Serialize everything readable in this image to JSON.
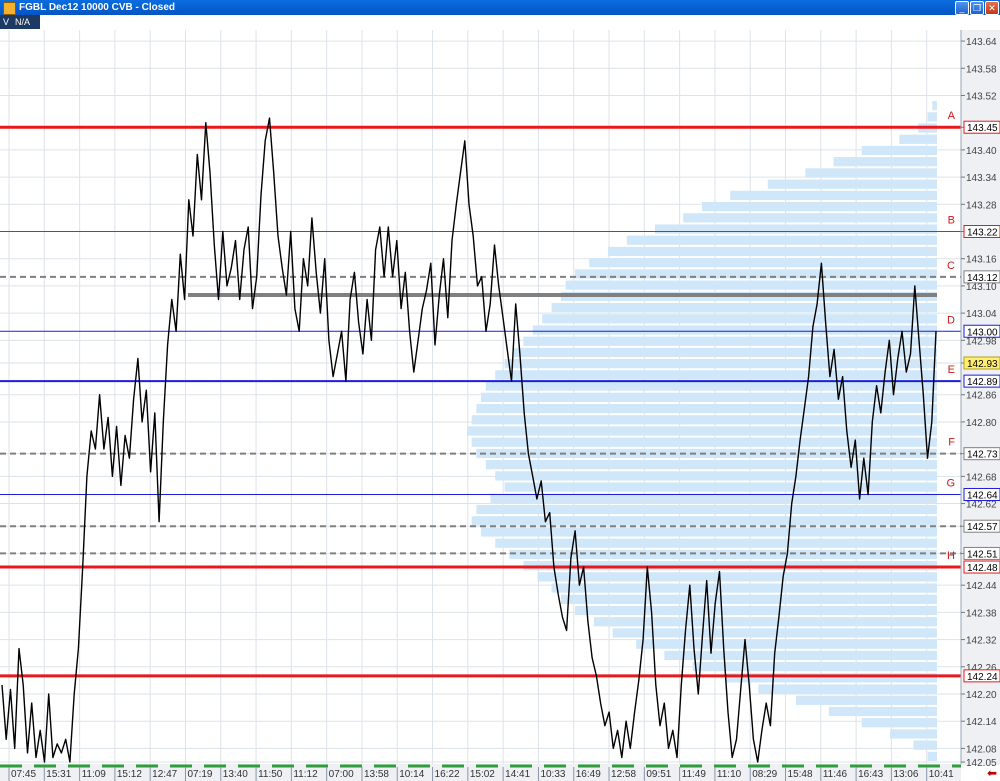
{
  "window": {
    "title": "FGBL Dec12 10000 CVB - Closed",
    "buttons": [
      "_",
      "❐",
      "✕"
    ]
  },
  "toolbar": {
    "v_label": "V",
    "na_label": "N/A"
  },
  "colors": {
    "price_line": "#000000",
    "profile_fill": "#cfe7f8",
    "red_level": "#e8181c",
    "blue_level": "#1d1de0",
    "gray_level": "#808080",
    "label_red": "#d01818",
    "current_price_box": "#ffee70"
  },
  "chart_data": {
    "type": "line",
    "title": "",
    "ylim": [
      142.05,
      143.66
    ],
    "y_ticks": [
      "143.64",
      "143.58",
      "143.52",
      "143.45",
      "143.40",
      "143.34",
      "143.28",
      "143.22",
      "143.16",
      "143.10",
      "143.04",
      "142.98",
      "142.93",
      "142.86",
      "142.80",
      "142.73",
      "142.68",
      "142.62",
      "142.57",
      "142.51",
      "142.44",
      "142.38",
      "142.32",
      "142.26",
      "142.20",
      "142.14",
      "142.08",
      "142.05"
    ],
    "x_ticks": [
      "07:45",
      "15:31",
      "11:09",
      "15:12",
      "12:47",
      "07:19",
      "13:40",
      "11:50",
      "11:12",
      "07:00",
      "13:58",
      "10:14",
      "16:22",
      "15:02",
      "14:41",
      "10:33",
      "16:49",
      "12:58",
      "09:51",
      "11:49",
      "11:10",
      "08:29",
      "15:48",
      "11:46",
      "16:43",
      "13:06",
      "10:41"
    ],
    "current_price": "142.93",
    "series": [
      {
        "values": [
          142.22,
          142.1,
          142.21,
          142.08,
          142.3,
          142.22,
          142.07,
          142.18,
          142.06,
          142.12,
          142.05,
          142.2,
          142.06,
          142.09,
          142.07,
          142.1,
          142.05,
          142.2,
          142.3,
          142.48,
          142.68,
          142.78,
          142.74,
          142.86,
          142.74,
          142.81,
          142.68,
          142.79,
          142.66,
          142.77,
          142.72,
          142.85,
          142.94,
          142.8,
          142.87,
          142.69,
          142.82,
          142.58,
          142.8,
          142.97,
          143.07,
          143.0,
          143.17,
          143.07,
          143.29,
          143.21,
          143.39,
          143.29,
          143.46,
          143.35,
          143.19,
          143.07,
          143.22,
          143.1,
          143.14,
          143.2,
          143.07,
          143.18,
          143.23,
          143.05,
          143.12,
          143.3,
          143.42,
          143.47,
          143.35,
          143.21,
          143.14,
          143.08,
          143.22,
          143.05,
          143.0,
          143.16,
          143.1,
          143.25,
          143.13,
          143.04,
          143.16,
          142.98,
          142.9,
          142.95,
          143.0,
          142.89,
          143.07,
          143.13,
          143.02,
          142.95,
          143.07,
          142.98,
          143.18,
          143.23,
          143.12,
          143.23,
          143.12,
          143.2,
          143.05,
          143.13,
          143.0,
          142.91,
          142.98,
          143.05,
          143.09,
          143.15,
          142.97,
          143.08,
          143.16,
          143.03,
          143.2,
          143.28,
          143.35,
          143.42,
          143.28,
          143.21,
          143.1,
          143.12,
          143.0,
          143.06,
          143.19,
          143.1,
          143.03,
          142.96,
          142.89,
          143.06,
          142.95,
          142.82,
          142.73,
          142.68,
          142.63,
          142.67,
          142.58,
          142.6,
          142.48,
          142.42,
          142.37,
          142.34,
          142.5,
          142.56,
          142.44,
          142.48,
          142.36,
          142.28,
          142.24,
          142.18,
          142.13,
          142.16,
          142.08,
          142.12,
          142.06,
          142.14,
          142.08,
          142.16,
          142.23,
          142.32,
          142.48,
          142.38,
          142.22,
          142.13,
          142.18,
          142.08,
          142.12,
          142.06,
          142.22,
          142.34,
          142.44,
          142.3,
          142.2,
          142.33,
          142.45,
          142.29,
          142.4,
          142.47,
          142.3,
          142.16,
          142.06,
          142.1,
          142.21,
          142.32,
          142.22,
          142.1,
          142.05,
          142.12,
          142.18,
          142.13,
          142.29,
          142.37,
          142.46,
          142.51,
          142.62,
          142.68,
          142.76,
          142.83,
          142.9,
          143.01,
          143.06,
          143.15,
          143.02,
          142.9,
          142.96,
          142.85,
          142.9,
          142.78,
          142.7,
          142.76,
          142.63,
          142.72,
          142.64,
          142.8,
          142.88,
          142.82,
          142.91,
          142.98,
          142.86,
          142.94,
          143.0,
          142.91,
          142.95,
          143.1,
          142.98,
          142.86,
          142.72,
          142.8,
          143.0
        ]
      }
    ],
    "levels": [
      {
        "label": "A",
        "price": 143.45,
        "color": "red",
        "style": "solid",
        "weight": "thick"
      },
      {
        "label": "B",
        "price": 143.22,
        "color": "red",
        "style": "solid",
        "weight": "thin"
      },
      {
        "label": "C",
        "price": 143.12,
        "color": "gray",
        "style": "dashed",
        "weight": "medium"
      },
      {
        "label": "",
        "price": 143.08,
        "color": "gray",
        "style": "solid",
        "weight": "thick"
      },
      {
        "label": "D",
        "price": 143.0,
        "color": "blue",
        "style": "solid",
        "weight": "thin"
      },
      {
        "label": "E",
        "price": 142.89,
        "color": "blue",
        "style": "solid",
        "weight": "medium"
      },
      {
        "label": "F",
        "price": 142.73,
        "color": "gray",
        "style": "dashed",
        "weight": "medium"
      },
      {
        "label": "G",
        "price": 142.64,
        "color": "blue",
        "style": "solid",
        "weight": "thin"
      },
      {
        "label": "",
        "price": 142.57,
        "color": "gray",
        "style": "dashed",
        "weight": "medium"
      },
      {
        "label": "",
        "price": 142.51,
        "color": "gray",
        "style": "dashed",
        "weight": "medium"
      },
      {
        "label": "H",
        "price": 142.48,
        "color": "red",
        "style": "solid",
        "weight": "thick"
      },
      {
        "label": "",
        "price": 142.24,
        "color": "red",
        "style": "solid",
        "weight": "thick"
      }
    ],
    "level_price_labels": [
      "143.45",
      "143.22",
      "143.12",
      "143.00",
      "142.89",
      "142.73",
      "142.64",
      "142.57",
      "142.51",
      "142.48",
      "142.24"
    ],
    "volume_profile": [
      0.01,
      0.02,
      0.04,
      0.08,
      0.16,
      0.22,
      0.28,
      0.36,
      0.44,
      0.5,
      0.54,
      0.6,
      0.66,
      0.7,
      0.74,
      0.77,
      0.79,
      0.8,
      0.82,
      0.84,
      0.86,
      0.88,
      0.9,
      0.92,
      0.94,
      0.96,
      0.97,
      0.98,
      0.99,
      1.0,
      0.99,
      0.98,
      0.96,
      0.94,
      0.92,
      0.95,
      0.98,
      0.99,
      0.97,
      0.94,
      0.91,
      0.88,
      0.85,
      0.82,
      0.8,
      0.77,
      0.73,
      0.69,
      0.64,
      0.58,
      0.52,
      0.45,
      0.38,
      0.3,
      0.23,
      0.16,
      0.1,
      0.05,
      0.02
    ]
  }
}
